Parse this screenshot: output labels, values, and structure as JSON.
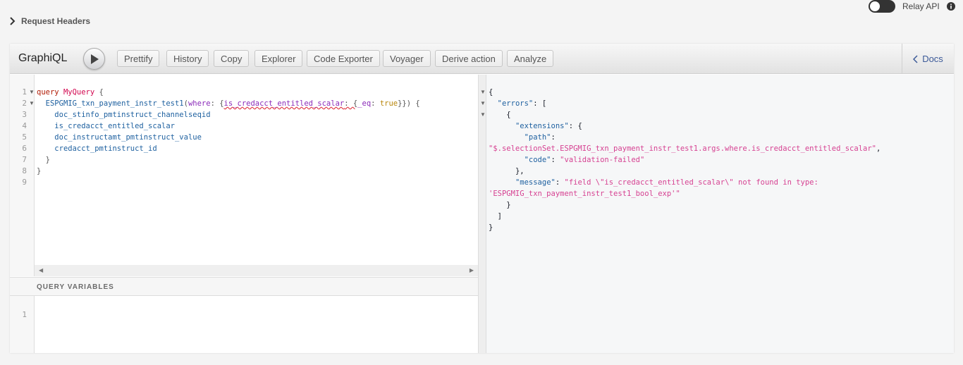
{
  "request_headers": {
    "label": "Request Headers"
  },
  "relay": {
    "label": "Relay API"
  },
  "toolbar": {
    "title": "GraphiQL",
    "buttons": [
      "Prettify",
      "History",
      "Copy",
      "Explorer",
      "Code Exporter",
      "Voyager",
      "Derive action",
      "Analyze"
    ],
    "docs_label": "Docs"
  },
  "editor": {
    "line_numbers": [
      "1",
      "2",
      "3",
      "4",
      "5",
      "6",
      "7",
      "8",
      "9"
    ],
    "query": {
      "keyword": "query",
      "name": "MyQuery",
      "open_brace": " {",
      "root_field": "ESPGMIG_txn_payment_instr_test1",
      "paren_open": "(",
      "where_arg": "where",
      "colon1": ": {",
      "invalid_field": "is_credacct_entitled_scalar",
      "colon2": ": {",
      "eq_arg": "_eq",
      "colon3": ": ",
      "bool_value": "true",
      "close_args": "}}) {",
      "fields": [
        "doc_stinfo_pmtinstruct_channelseqid",
        "is_credacct_entitled_scalar",
        "doc_instructamt_pmtinstruct_value",
        "credacct_pmtinstruct_id"
      ],
      "close_inner": "}",
      "close_outer": "}"
    }
  },
  "query_variables": {
    "header": "QUERY VARIABLES",
    "line_numbers": [
      "1"
    ]
  },
  "result": {
    "open": "{",
    "errors_key": "\"errors\"",
    "errors_open": ": [",
    "obj_open": "{",
    "extensions_key": "\"extensions\"",
    "extensions_open": ": {",
    "path_key": "\"path\"",
    "path_colon": ":",
    "path_value": "\"$.selectionSet.ESPGMIG_txn_payment_instr_test1.args.where.is_credacct_entitled_scalar\"",
    "comma": ",",
    "code_key": "\"code\"",
    "code_colon": ": ",
    "code_value": "\"validation-failed\"",
    "extensions_close": "},",
    "message_key": "\"message\"",
    "message_colon": ": ",
    "message_value_1": "\"field \\\"is_credacct_entitled_scalar\\\" not found in type:",
    "message_value_2": "'ESPGMIG_txn_payment_instr_test1_bool_exp'\"",
    "obj_close": "}",
    "errors_close": "]",
    "close": "}"
  },
  "colors": {
    "keyword": "#b11a04",
    "def": "#d2054e",
    "field": "#1f61a0",
    "attribute": "#8b2bb9",
    "string": "#d64292",
    "docs_link": "#3b5998"
  }
}
